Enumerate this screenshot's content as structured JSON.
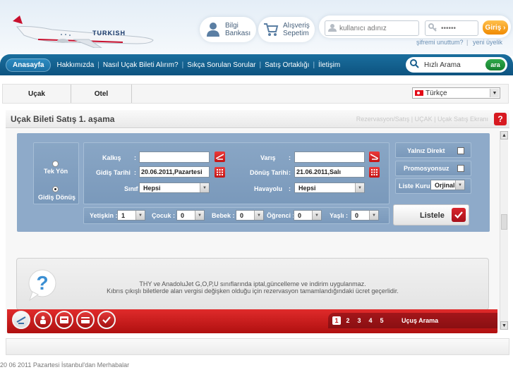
{
  "brand": {
    "name": "TURKISH"
  },
  "header": {
    "bilgi": {
      "line1": "Bilgi",
      "line2": "Bankası"
    },
    "sepet": {
      "line1": "Alışveriş",
      "line2": "Sepetim"
    },
    "username_placeholder": "kullanıcı adınız",
    "password_value": "••••••",
    "login_label": "Giriş ›",
    "forgot_label": "şifremi unuttum?",
    "sep": "|",
    "register_label": "yeni üyelik"
  },
  "nav": {
    "active": "Anasayfa",
    "items": [
      "Hakkımızda",
      "Nasıl Uçak Bileti Alırım?",
      "Sıkça Sorulan Sorular",
      "Satış Ortaklığı",
      "İletişim"
    ],
    "divider": "|",
    "quick_search": "Hızlı Arama",
    "search_button": "ara"
  },
  "subtabs": [
    "Uçak",
    "Otel"
  ],
  "language": {
    "selected": "Türkçe"
  },
  "page": {
    "title": "Uçak Bileti Satış 1. aşama",
    "breadcrumb": "Rezervasyon/Satış | UÇAK | Uçak Satış Ekranı",
    "help": "?"
  },
  "form": {
    "trip": {
      "one_way": "Tek Yön",
      "round_trip": "Gidiş Dönüş"
    },
    "colon": ":",
    "kalkis_label": "Kalkış",
    "varis_label": "Varış",
    "gidis_label": "Gidiş Tarihi",
    "gidis_value": "20.06.2011,Pazartesi",
    "donus_label": "Dönüş Tarihi",
    "donus_value": "21.06.2011,Salı",
    "sinif_label": "Sınıf",
    "sinif_value": "Hepsi",
    "havayolu_label": "Havayolu",
    "havayolu_value": "Hepsi",
    "yalniz_direkt": "Yalnız Direkt",
    "promosyonsuz": "Promosyonsuz",
    "liste_kuru_label": "Liste Kuru:",
    "liste_kuru_value": "Orjinal",
    "pax": [
      {
        "label": "Yetişkin :",
        "value": "1"
      },
      {
        "label": "Çocuk :",
        "value": "0"
      },
      {
        "label": "Bebek :",
        "value": "0"
      },
      {
        "label": "Öğrenci :",
        "value": "0"
      },
      {
        "label": "Yaşlı :",
        "value": "0"
      }
    ],
    "list_button": "Listele"
  },
  "info": {
    "line1": "THY ve AnadoluJet G,O,P,U sınıflarında iptal,güncelleme ve indirim uygulanmaz.",
    "line2": "Kıbrıs çıkışlı biletlerde alan vergisi değişken olduğu için rezervasyon tamamlandığındaki ücret geçerlidir."
  },
  "steps": {
    "numbers": [
      "1",
      "2",
      "3",
      "4",
      "5"
    ],
    "active": 1,
    "label": "Uçuş Arama"
  },
  "footer": {
    "text": "20 06 2011 Pazartesi İstanbul'dan Merhabalar"
  }
}
